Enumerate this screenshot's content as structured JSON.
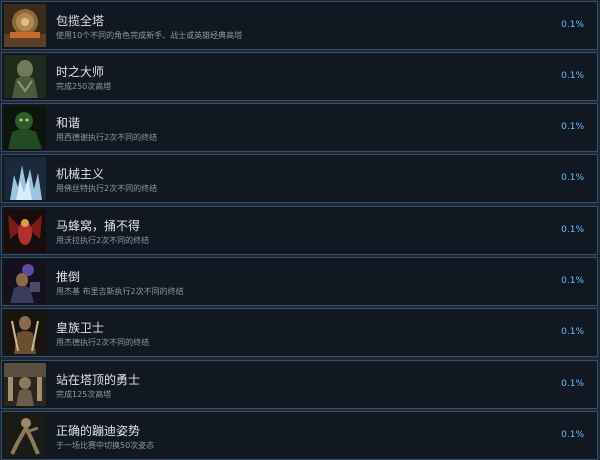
{
  "achievements": [
    {
      "title": "包揽全塔",
      "description": "使用10个不同的角色完成新手、战士或英雄经典高塔",
      "percent": "0.1%",
      "icon": "tower-gate-icon"
    },
    {
      "title": "时之大师",
      "description": "完成250次高塔",
      "percent": "0.1%",
      "icon": "time-master-icon"
    },
    {
      "title": "和谐",
      "description": "用西德谢执行2次不同的终结",
      "percent": "0.1%",
      "icon": "sheeva-icon"
    },
    {
      "title": "机械主义",
      "description": "用佛丝特执行2次不同的终结",
      "percent": "0.1%",
      "icon": "frost-icon"
    },
    {
      "title": "马蜂窝，捅不得",
      "description": "用沃拉执行2次不同的终结",
      "percent": "0.1%",
      "icon": "dvorah-icon"
    },
    {
      "title": "推倒",
      "description": "用杰基 布里吉斯执行2次不同的终结",
      "percent": "0.1%",
      "icon": "jacqui-briggs-icon"
    },
    {
      "title": "皇族卫士",
      "description": "用杰德执行2次不同的终结",
      "percent": "0.1%",
      "icon": "jade-icon"
    },
    {
      "title": "站在塔顶的勇士",
      "description": "完成125次高塔",
      "percent": "0.1%",
      "icon": "tower-champion-icon"
    },
    {
      "title": "正确的蹦迪姿势",
      "description": "于一场比赛中切换50次姿态",
      "percent": "0.1%",
      "icon": "stance-fighter-icon"
    }
  ]
}
